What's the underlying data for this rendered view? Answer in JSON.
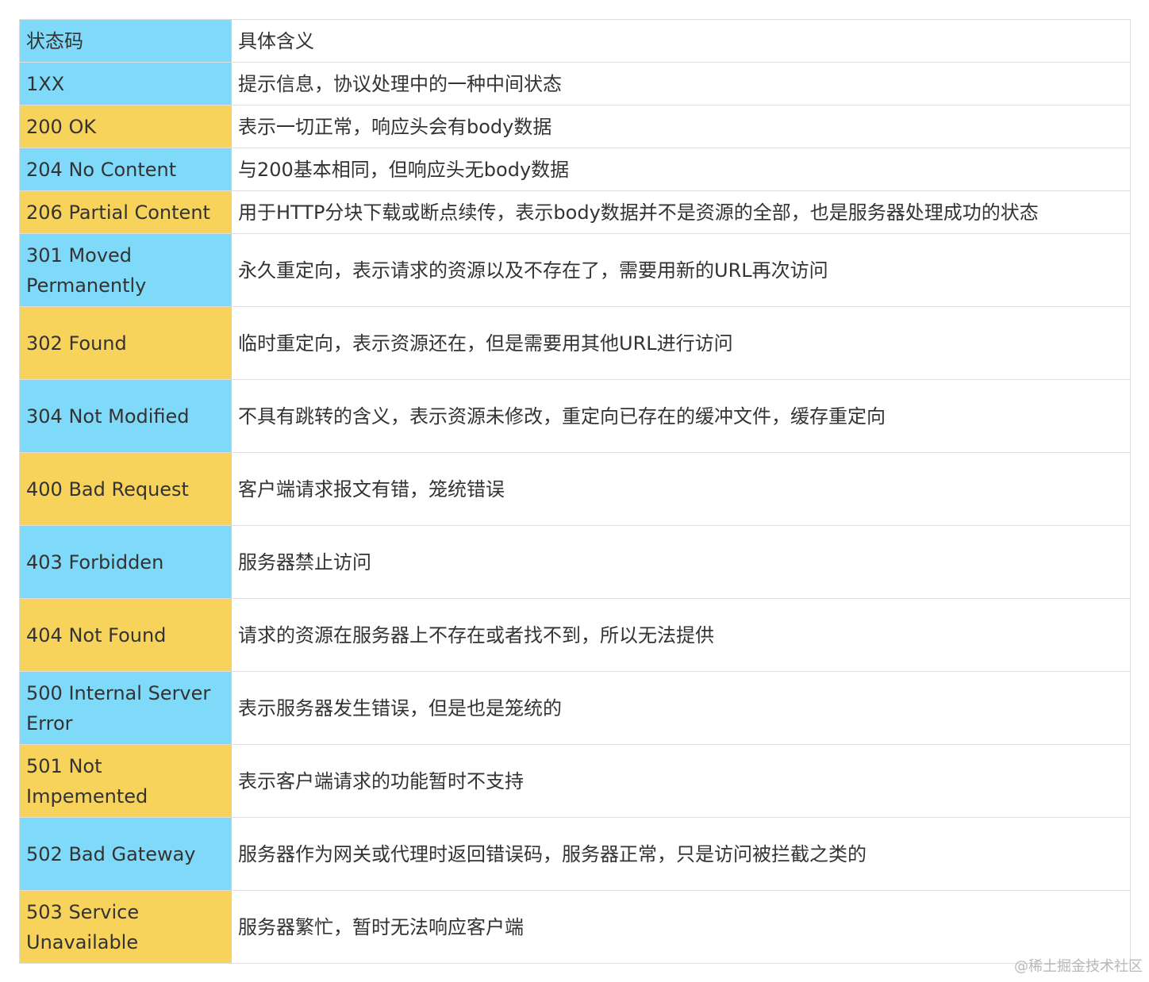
{
  "table": {
    "header": {
      "code": "状态码",
      "meaning": "具体含义"
    },
    "rows": [
      {
        "code": "1XX",
        "meaning": "提示信息，协议处理中的一种中间状态"
      },
      {
        "code": "200 OK",
        "meaning": "表示一切正常，响应头会有body数据"
      },
      {
        "code": "204 No Content",
        "meaning": "与200基本相同，但响应头无body数据"
      },
      {
        "code": "206 Partial Content",
        "meaning": "用于HTTP分块下载或断点续传，表示body数据并不是资源的全部，也是服务器处理成功的状态"
      },
      {
        "code": "301 Moved Permanently",
        "meaning": "永久重定向，表示请求的资源以及不存在了，需要用新的URL再次访问"
      },
      {
        "code": "302 Found",
        "meaning": "临时重定向，表示资源还在，但是需要用其他URL进行访问"
      },
      {
        "code": "304 Not Modified",
        "meaning": "不具有跳转的含义，表示资源未修改，重定向已存在的缓冲文件，缓存重定向"
      },
      {
        "code": "400 Bad Request",
        "meaning": "客户端请求报文有错，笼统错误"
      },
      {
        "code": "403 Forbidden",
        "meaning": "服务器禁止访问"
      },
      {
        "code": "404 Not Found",
        "meaning": "请求的资源在服务器上不存在或者找不到，所以无法提供"
      },
      {
        "code": "500 Internal Server Error",
        "meaning": "表示服务器发生错误，但是也是笼统的"
      },
      {
        "code": "501 Not Impemented",
        "meaning": "表示客户端请求的功能暂时不支持"
      },
      {
        "code": "502 Bad Gateway",
        "meaning": "服务器作为网关或代理时返回错误码，服务器正常，只是访问被拦截之类的"
      },
      {
        "code": "503 Service Unavailable",
        "meaning": "服务器繁忙，暂时无法响应客户端"
      }
    ]
  },
  "watermark": "@稀土掘金技术社区",
  "colors": {
    "blue_cell": "#7fd9f8",
    "yellow_cell": "#f8d35c"
  }
}
